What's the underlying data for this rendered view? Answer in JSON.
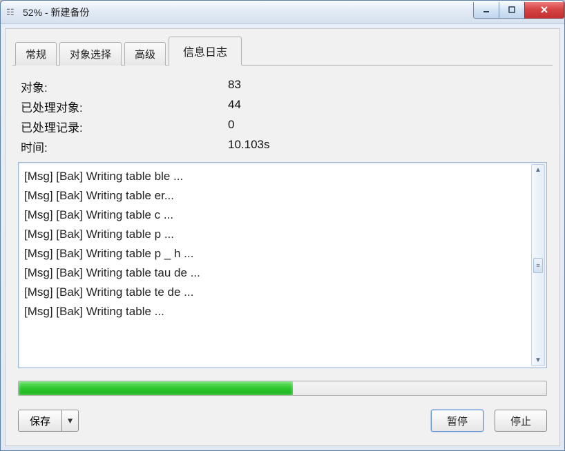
{
  "window": {
    "title": "52% - 新建备份"
  },
  "tabs": {
    "items": [
      {
        "label": "常规"
      },
      {
        "label": "对象选择"
      },
      {
        "label": "高级"
      },
      {
        "label": "信息日志"
      }
    ],
    "active_index": 3
  },
  "stats": {
    "object_label": "对象:",
    "object_value": "83",
    "processed_obj_label": "已处理对象:",
    "processed_obj_value": "44",
    "processed_rec_label": "已处理记录:",
    "processed_rec_value": "0",
    "time_label": "时间:",
    "time_value": "10.103s"
  },
  "log": {
    "lines": [
      "[Msg] [Bak] Writing table              ble          ...",
      "[Msg] [Bak] Writing table                       er...",
      "[Msg] [Bak] Writing table c                        ...",
      "[Msg] [Bak] Writing table p                  ...",
      "[Msg] [Bak] Writing table p          _       h      ...",
      "[Msg] [Bak] Writing table        tau       de     ...",
      "[Msg] [Bak] Writing table         te            de  ...",
      "[Msg] [Bak] Writing table                                         ..."
    ]
  },
  "progress": {
    "percent": 52
  },
  "buttons": {
    "save": "保存",
    "pause": "暂停",
    "stop": "停止"
  }
}
